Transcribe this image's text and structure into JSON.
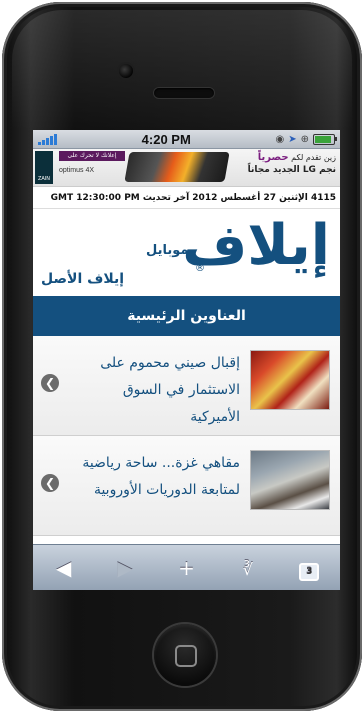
{
  "status": {
    "time": "4:20 PM",
    "icons": [
      "signal-icon",
      "location-icon",
      "lock-rotation-icon",
      "battery-icon"
    ],
    "battery_level": 0.8
  },
  "ad": {
    "brand": "ZAIN",
    "tag": "إعلانك لا تحرك على",
    "product": "optimus 4X",
    "line1": "زين تقدم لكم",
    "line1_bold": "حصرياً",
    "line2": "نجم LG الجديد مجاناً"
  },
  "dateline": "4115 الإثنين 27 أغسطس 2012 آخر تحديث GMT 12:30:00 PM",
  "logo": {
    "main": "إيلاف",
    "mobile": "موبايل",
    "reg": "®",
    "sub": "إيلاف الأصل"
  },
  "section": {
    "title": "العناوين الرئيسية"
  },
  "news": [
    {
      "line1": "إقبال صيني محموم على",
      "line2": "الاستثمار في السوق الأميركية"
    },
    {
      "line1": "مقاهي غزة... ساحة رياضية",
      "line2": "لمتابعة الدوريات الأوروبية"
    }
  ],
  "toolbar": {
    "back": "◀",
    "forward": "▶",
    "add": "+",
    "bookmarks": "📖",
    "tabs": "3"
  }
}
